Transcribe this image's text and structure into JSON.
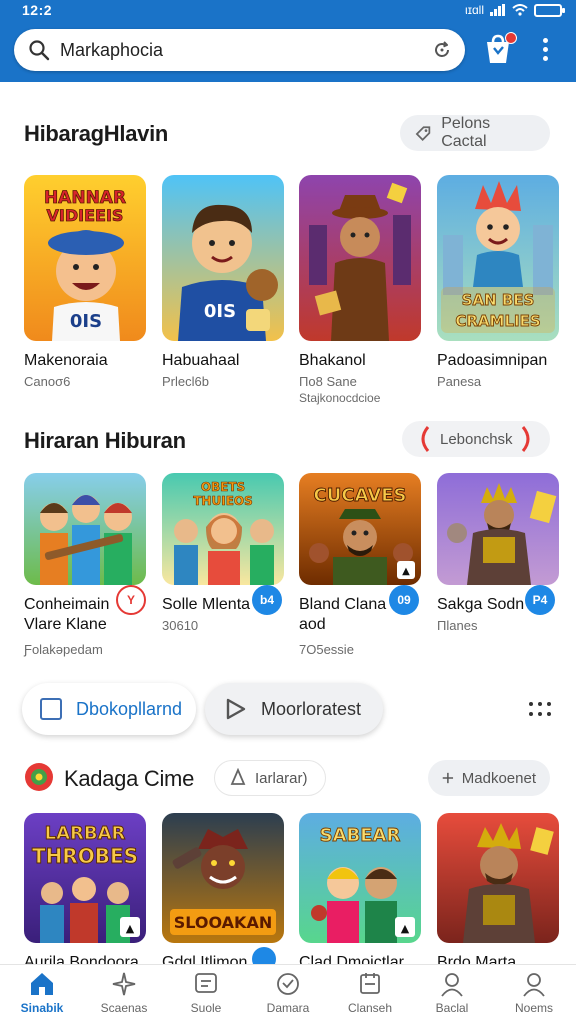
{
  "status": {
    "time": "12:2",
    "signal_label": "ιɪɑll"
  },
  "search": {
    "value": "Markaphocia"
  },
  "sections": [
    {
      "title": "HibaragHlavin",
      "action": "Pelons Cactal",
      "items": [
        {
          "name": "Makenoraia",
          "sub": "Canoσ6"
        },
        {
          "name": "Habuahaal",
          "sub": "Prlecl6b"
        },
        {
          "name": "Bhakanol",
          "sub": "Πο8 Sane",
          "sub2": "Stajkonocdcioe"
        },
        {
          "name": "Padoasimnipan",
          "sub": "Panesa"
        }
      ]
    },
    {
      "title": "Hiraran Hiburan",
      "action": "Lebonchsk",
      "items": [
        {
          "name": "Conheimain",
          "name2": "Vlare Klane",
          "sub": "Ƒolakəpedam",
          "badge": "Y"
        },
        {
          "name": "Solle Mlenta",
          "sub": "30610",
          "badge": "b4"
        },
        {
          "name": "Bland Clana",
          "name2": "aod",
          "sub": "7O5essie",
          "badge": "09"
        },
        {
          "name": "Sakga Sodn",
          "sub": "Πlanes",
          "badge": "P4"
        }
      ]
    }
  ],
  "toggles": {
    "left": "Dbokopllarnd",
    "right": "Moorloratest"
  },
  "section3": {
    "title": "Kadaga Cime",
    "chip": "Iarlarar)",
    "action": "Madkoenet",
    "items": [
      {
        "name": "Aurila Bondoora"
      },
      {
        "name": "Gdgl Itlimon"
      },
      {
        "name": "Clad Dmoictlar"
      },
      {
        "name": "Brdo Marta"
      }
    ]
  },
  "bottom_nav": [
    {
      "label": "Sinabik",
      "icon": "home-icon",
      "active": true
    },
    {
      "label": "Scaenas",
      "icon": "sparkle-icon"
    },
    {
      "label": "Suole",
      "icon": "chat-icon"
    },
    {
      "label": "Damara",
      "icon": "clock-icon"
    },
    {
      "label": "Clanseh",
      "icon": "book-icon"
    },
    {
      "label": "Baclal",
      "icon": "person-icon"
    },
    {
      "label": "Noems",
      "icon": "profile-icon"
    }
  ],
  "colors": {
    "primary": "#1a73c8",
    "badge_red": "#e53935",
    "badge_blue": "#1e88e5"
  }
}
